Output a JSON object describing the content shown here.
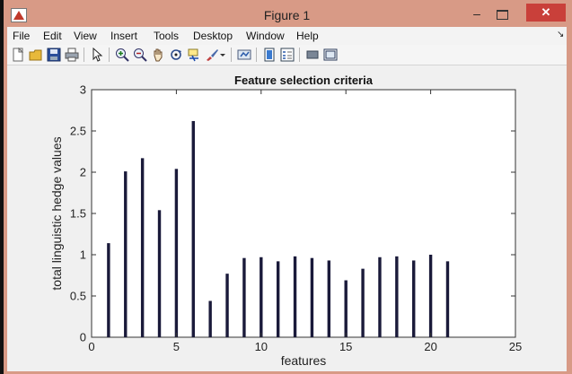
{
  "window": {
    "title": "Figure 1",
    "minimize_glyph": "–",
    "close_glyph": "✕"
  },
  "menu": {
    "items": [
      "File",
      "Edit",
      "View",
      "Insert",
      "Tools",
      "Desktop",
      "Window",
      "Help"
    ],
    "overflow_glyph": "↘"
  },
  "toolbar": {
    "icons": [
      "new-figure-icon",
      "open-file-icon",
      "save-icon",
      "print-icon",
      "pointer-icon",
      "zoom-in-icon",
      "zoom-out-icon",
      "pan-icon",
      "rotate-icon",
      "data-cursor-icon",
      "brush-icon",
      "brush-dropdown-icon",
      "link-plot-icon",
      "colorbar-icon",
      "legend-icon",
      "hide-plot-tools-icon",
      "show-plot-tools-icon"
    ]
  },
  "chart_data": {
    "type": "bar",
    "title": "Feature selection criteria",
    "xlabel": "features",
    "ylabel": "total linguistic hedge values",
    "x": [
      1,
      2,
      3,
      4,
      5,
      6,
      7,
      8,
      9,
      10,
      11,
      12,
      13,
      14,
      15,
      16,
      17,
      18,
      19,
      20,
      21
    ],
    "values": [
      1.14,
      2.01,
      2.17,
      1.54,
      2.04,
      2.62,
      0.44,
      0.77,
      0.96,
      0.97,
      0.92,
      0.98,
      0.96,
      0.93,
      0.69,
      0.83,
      0.97,
      0.98,
      0.93,
      1.0,
      0.92
    ],
    "xlim": [
      0,
      25
    ],
    "ylim": [
      0,
      3
    ],
    "xticks": [
      0,
      5,
      10,
      15,
      20,
      25
    ],
    "yticks": [
      0,
      0.5,
      1,
      1.5,
      2,
      2.5,
      3
    ],
    "ytick_labels": [
      "0",
      "0.5",
      "1",
      "1.5",
      "2",
      "2.5",
      "3"
    ],
    "bar_color": "#1a1a3a",
    "grid": false,
    "box": true
  },
  "colors": {
    "frame": "#d89a86",
    "close_button": "#c9403a",
    "figure_background": "#f0f0f0",
    "axes_background": "#ffffff"
  }
}
